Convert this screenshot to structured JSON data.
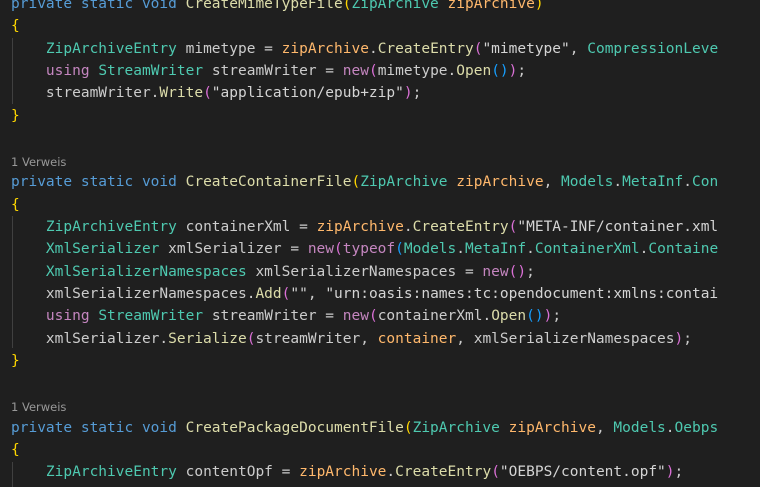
{
  "editor": {
    "codelens": {
      "ref_count_label": "1 Verweis"
    },
    "lines": [
      {
        "kind": "code",
        "tokens": [
          {
            "t": "private static void ",
            "c": "kw"
          },
          {
            "t": "CreateMimeTypeFile",
            "c": "fn"
          },
          {
            "t": "(",
            "c": "brace"
          },
          {
            "t": "ZipArchive ",
            "c": "type"
          },
          {
            "t": "zipArchive",
            "c": "param"
          },
          {
            "t": ")",
            "c": "brace"
          }
        ]
      },
      {
        "kind": "code",
        "tokens": [
          {
            "t": "{",
            "c": "brace"
          }
        ]
      },
      {
        "kind": "code",
        "tokens": [
          {
            "t": "    ZipArchiveEntry ",
            "c": "type"
          },
          {
            "t": "mimetype = ",
            "c": "plain"
          },
          {
            "t": "zipArchive",
            "c": "param"
          },
          {
            "t": ".",
            "c": "plain"
          },
          {
            "t": "CreateEntry",
            "c": "method"
          },
          {
            "t": "(",
            "c": "brace2"
          },
          {
            "t": "\"mimetype\"",
            "c": "strw"
          },
          {
            "t": ", ",
            "c": "plain"
          },
          {
            "t": "CompressionLeve",
            "c": "type"
          }
        ]
      },
      {
        "kind": "code",
        "tokens": [
          {
            "t": "    using ",
            "c": "kw2"
          },
          {
            "t": "StreamWriter ",
            "c": "type"
          },
          {
            "t": "streamWriter = ",
            "c": "plain"
          },
          {
            "t": "new",
            "c": "kw2"
          },
          {
            "t": "(",
            "c": "brace2"
          },
          {
            "t": "mimetype.",
            "c": "plain"
          },
          {
            "t": "Open",
            "c": "method"
          },
          {
            "t": "()",
            "c": "brace3"
          },
          {
            "t": ")",
            "c": "brace2"
          },
          {
            "t": ";",
            "c": "plain"
          }
        ]
      },
      {
        "kind": "code",
        "tokens": [
          {
            "t": "    streamWriter.",
            "c": "plain"
          },
          {
            "t": "Write",
            "c": "method"
          },
          {
            "t": "(",
            "c": "brace2"
          },
          {
            "t": "\"application/epub+zip\"",
            "c": "strw"
          },
          {
            "t": ")",
            "c": "brace2"
          },
          {
            "t": ";",
            "c": "plain"
          }
        ]
      },
      {
        "kind": "code",
        "tokens": [
          {
            "t": "}",
            "c": "brace"
          }
        ]
      },
      {
        "kind": "blank"
      },
      {
        "kind": "codelens"
      },
      {
        "kind": "code",
        "tokens": [
          {
            "t": "private static void ",
            "c": "kw"
          },
          {
            "t": "CreateContainerFile",
            "c": "fn"
          },
          {
            "t": "(",
            "c": "brace"
          },
          {
            "t": "ZipArchive ",
            "c": "type"
          },
          {
            "t": "zipArchive",
            "c": "param"
          },
          {
            "t": ", ",
            "c": "plain"
          },
          {
            "t": "Models",
            "c": "ns"
          },
          {
            "t": ".",
            "c": "plain"
          },
          {
            "t": "MetaInf",
            "c": "ns"
          },
          {
            "t": ".",
            "c": "plain"
          },
          {
            "t": "Con",
            "c": "ns"
          }
        ]
      },
      {
        "kind": "code",
        "tokens": [
          {
            "t": "{",
            "c": "brace"
          }
        ]
      },
      {
        "kind": "code",
        "tokens": [
          {
            "t": "    ZipArchiveEntry ",
            "c": "type"
          },
          {
            "t": "containerXml = ",
            "c": "plain"
          },
          {
            "t": "zipArchive",
            "c": "param"
          },
          {
            "t": ".",
            "c": "plain"
          },
          {
            "t": "CreateEntry",
            "c": "method"
          },
          {
            "t": "(",
            "c": "brace2"
          },
          {
            "t": "\"META-INF/container.xml",
            "c": "strw"
          }
        ]
      },
      {
        "kind": "code",
        "tokens": [
          {
            "t": "    XmlSerializer ",
            "c": "type"
          },
          {
            "t": "xmlSerializer = ",
            "c": "plain"
          },
          {
            "t": "new",
            "c": "kw2"
          },
          {
            "t": "(",
            "c": "brace2"
          },
          {
            "t": "typeof",
            "c": "kw2"
          },
          {
            "t": "(",
            "c": "brace3"
          },
          {
            "t": "Models",
            "c": "ns"
          },
          {
            "t": ".",
            "c": "plain"
          },
          {
            "t": "MetaInf",
            "c": "ns"
          },
          {
            "t": ".",
            "c": "plain"
          },
          {
            "t": "ContainerXml",
            "c": "ns"
          },
          {
            "t": ".",
            "c": "plain"
          },
          {
            "t": "Containe",
            "c": "ns"
          }
        ]
      },
      {
        "kind": "code",
        "tokens": [
          {
            "t": "    XmlSerializerNamespaces ",
            "c": "type"
          },
          {
            "t": "xmlSerializerNamespaces = ",
            "c": "plain"
          },
          {
            "t": "new",
            "c": "kw2"
          },
          {
            "t": "()",
            "c": "brace2"
          },
          {
            "t": ";",
            "c": "plain"
          }
        ]
      },
      {
        "kind": "code",
        "tokens": [
          {
            "t": "    xmlSerializerNamespaces.",
            "c": "plain"
          },
          {
            "t": "Add",
            "c": "method"
          },
          {
            "t": "(",
            "c": "brace2"
          },
          {
            "t": "\"\"",
            "c": "strw"
          },
          {
            "t": ", ",
            "c": "plain"
          },
          {
            "t": "\"urn:oasis:names:tc:opendocument:xmlns:contai",
            "c": "strw"
          }
        ]
      },
      {
        "kind": "code",
        "tokens": [
          {
            "t": "    using ",
            "c": "kw2"
          },
          {
            "t": "StreamWriter ",
            "c": "type"
          },
          {
            "t": "streamWriter = ",
            "c": "plain"
          },
          {
            "t": "new",
            "c": "kw2"
          },
          {
            "t": "(",
            "c": "brace2"
          },
          {
            "t": "containerXml.",
            "c": "plain"
          },
          {
            "t": "Open",
            "c": "method"
          },
          {
            "t": "()",
            "c": "brace3"
          },
          {
            "t": ")",
            "c": "brace2"
          },
          {
            "t": ";",
            "c": "plain"
          }
        ]
      },
      {
        "kind": "code",
        "tokens": [
          {
            "t": "    xmlSerializer.",
            "c": "plain"
          },
          {
            "t": "Serialize",
            "c": "method"
          },
          {
            "t": "(",
            "c": "brace2"
          },
          {
            "t": "streamWriter, ",
            "c": "plain"
          },
          {
            "t": "container",
            "c": "param"
          },
          {
            "t": ", xmlSerializerNamespaces",
            "c": "plain"
          },
          {
            "t": ")",
            "c": "brace2"
          },
          {
            "t": ";",
            "c": "plain"
          }
        ]
      },
      {
        "kind": "code",
        "tokens": [
          {
            "t": "}",
            "c": "brace"
          }
        ]
      },
      {
        "kind": "blank"
      },
      {
        "kind": "codelens"
      },
      {
        "kind": "code",
        "tokens": [
          {
            "t": "private static void ",
            "c": "kw"
          },
          {
            "t": "CreatePackageDocumentFile",
            "c": "fn"
          },
          {
            "t": "(",
            "c": "brace"
          },
          {
            "t": "ZipArchive ",
            "c": "type"
          },
          {
            "t": "zipArchive",
            "c": "param"
          },
          {
            "t": ", ",
            "c": "plain"
          },
          {
            "t": "Models",
            "c": "ns"
          },
          {
            "t": ".",
            "c": "plain"
          },
          {
            "t": "Oebps",
            "c": "ns"
          }
        ]
      },
      {
        "kind": "code",
        "tokens": [
          {
            "t": "{",
            "c": "brace"
          }
        ]
      },
      {
        "kind": "code",
        "tokens": [
          {
            "t": "    ZipArchiveEntry ",
            "c": "type"
          },
          {
            "t": "contentOpf = ",
            "c": "plain"
          },
          {
            "t": "zipArchive",
            "c": "param"
          },
          {
            "t": ".",
            "c": "plain"
          },
          {
            "t": "CreateEntry",
            "c": "method"
          },
          {
            "t": "(",
            "c": "brace2"
          },
          {
            "t": "\"OEBPS/content.opf\"",
            "c": "strw"
          },
          {
            "t": ")",
            "c": "brace2"
          },
          {
            "t": ";",
            "c": "plain"
          }
        ]
      }
    ]
  }
}
